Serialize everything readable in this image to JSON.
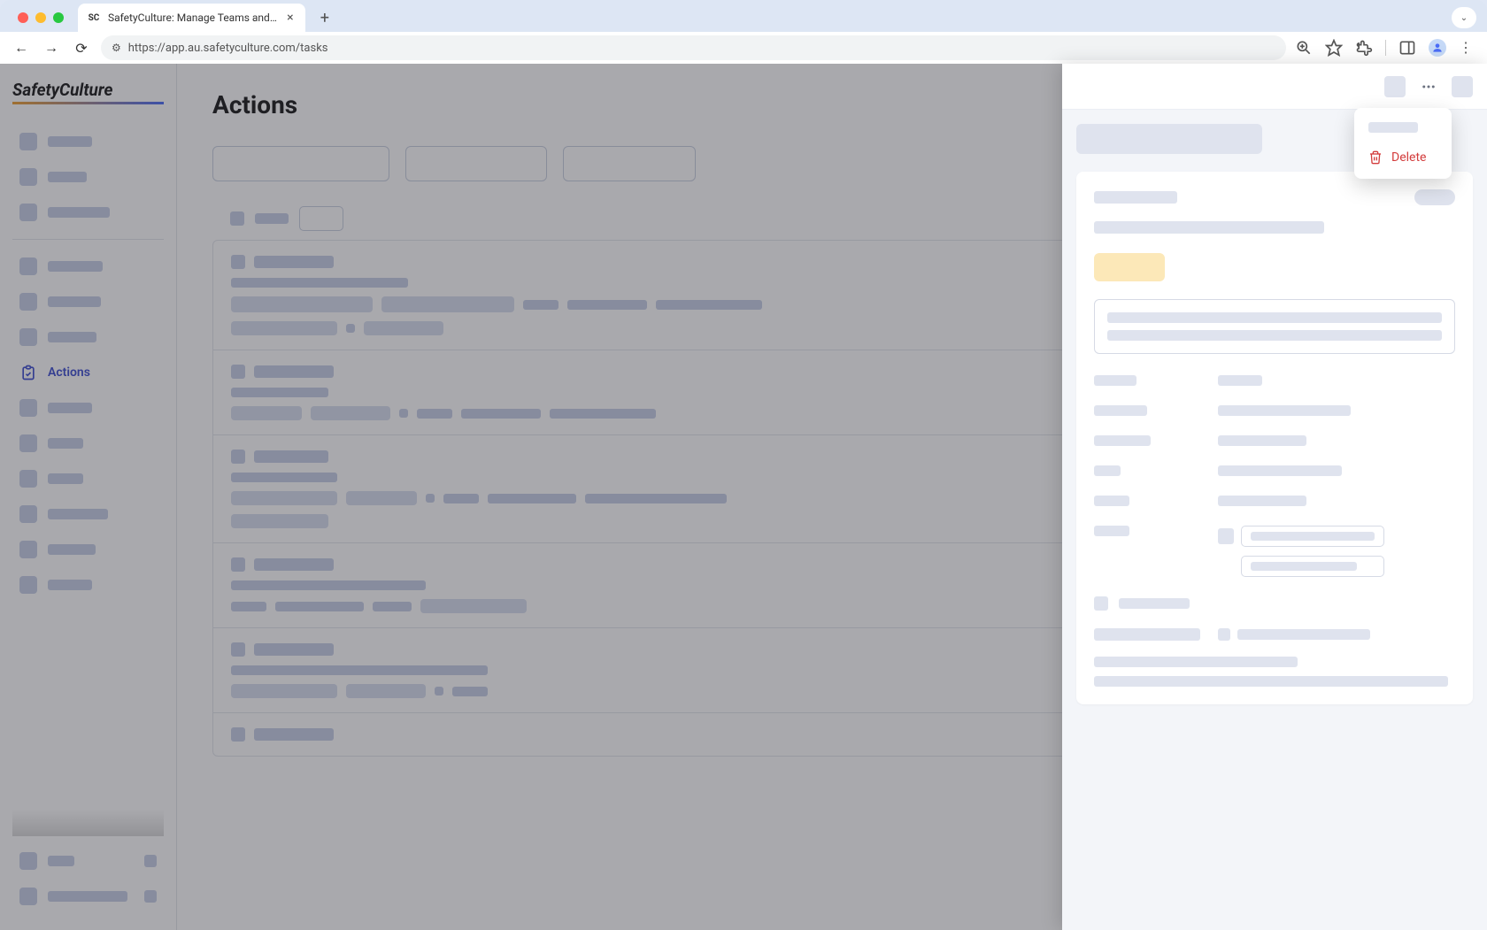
{
  "browser": {
    "tab_title": "SafetyCulture: Manage Teams and…",
    "url": "https://app.au.safetyculture.com/tasks"
  },
  "logo": "SafetyCulture",
  "sidebar": {
    "active_item": "Actions"
  },
  "page": {
    "title": "Actions"
  },
  "drawer": {
    "menu": {
      "delete_label": "Delete"
    }
  }
}
